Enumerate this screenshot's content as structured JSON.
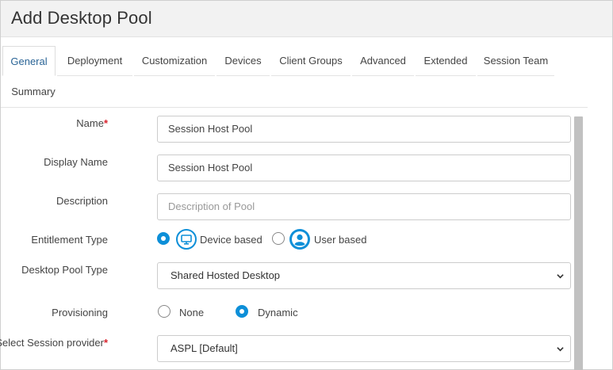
{
  "window": {
    "title": "Add Desktop Pool"
  },
  "tabs": [
    {
      "label": "General",
      "active": true
    },
    {
      "label": "Deployment",
      "active": false
    },
    {
      "label": "Customization",
      "active": false
    },
    {
      "label": "Devices",
      "active": false
    },
    {
      "label": "Client Groups",
      "active": false
    },
    {
      "label": "Advanced",
      "active": false
    },
    {
      "label": "Extended",
      "active": false
    },
    {
      "label": "Session Team",
      "active": false
    },
    {
      "label": "Summary",
      "active": false
    }
  ],
  "form": {
    "name": {
      "label": "Name",
      "required_mark": "*",
      "value": "Session Host Pool"
    },
    "display_name": {
      "label": "Display Name",
      "value": "Session Host Pool"
    },
    "description": {
      "label": "Description",
      "value": "",
      "placeholder": "Description of Pool"
    },
    "entitlement_type": {
      "label": "Entitlement Type",
      "options": [
        {
          "label": "Device based",
          "checked": true,
          "icon": "monitor-icon"
        },
        {
          "label": "User based",
          "checked": false,
          "icon": "user-icon"
        }
      ]
    },
    "desktop_pool_type": {
      "label": "Desktop Pool Type",
      "selected": "Shared Hosted Desktop"
    },
    "provisioning": {
      "label": "Provisioning",
      "options": [
        {
          "label": "None",
          "checked": false
        },
        {
          "label": "Dynamic",
          "checked": true
        }
      ]
    },
    "session_provider": {
      "label": "Select Session provider",
      "required_mark": "*",
      "selected": "ASPL [Default]"
    }
  },
  "colors": {
    "accent": "#0d8fd8",
    "active_tab_text": "#2a6496",
    "required": "#d9232d"
  }
}
